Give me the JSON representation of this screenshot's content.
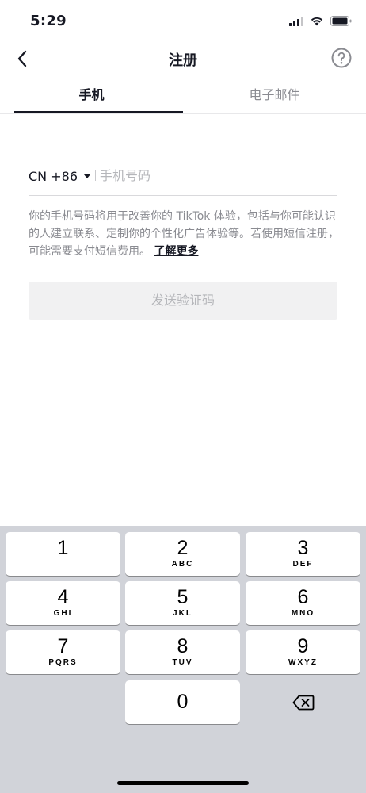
{
  "status_bar": {
    "time": "5:29",
    "icons": [
      "signal-icon",
      "wifi-icon",
      "battery-icon"
    ]
  },
  "header": {
    "title": "注册",
    "back_icon": "chevron-left-icon",
    "help_icon": "question-circle-icon"
  },
  "tabs": [
    {
      "label": "手机",
      "active": true
    },
    {
      "label": "电子邮件",
      "active": false
    }
  ],
  "phone_form": {
    "country_code": "CN +86",
    "placeholder": "手机号码",
    "value": ""
  },
  "notice": {
    "text": "你的手机号码将用于改善你的 TikTok 体验，包括与你可能认识的人建立联系、定制你的个性化广告体验等。若使用短信注册，可能需要支付短信费用。",
    "link": "了解更多"
  },
  "send_button": {
    "label": "发送验证码",
    "enabled": false
  },
  "keypad": {
    "keys": [
      {
        "num": "1",
        "letters": ""
      },
      {
        "num": "2",
        "letters": "ABC"
      },
      {
        "num": "3",
        "letters": "DEF"
      },
      {
        "num": "4",
        "letters": "GHI"
      },
      {
        "num": "5",
        "letters": "JKL"
      },
      {
        "num": "6",
        "letters": "MNO"
      },
      {
        "num": "7",
        "letters": "PQRS"
      },
      {
        "num": "8",
        "letters": "TUV"
      },
      {
        "num": "9",
        "letters": "WXYZ"
      }
    ],
    "zero": "0",
    "delete_icon": "backspace-icon"
  },
  "colors": {
    "text_primary": "#161823",
    "text_secondary": "#8a8b91",
    "button_disabled_bg": "#f1f1f2",
    "keyboard_bg": "#d1d3d9"
  }
}
